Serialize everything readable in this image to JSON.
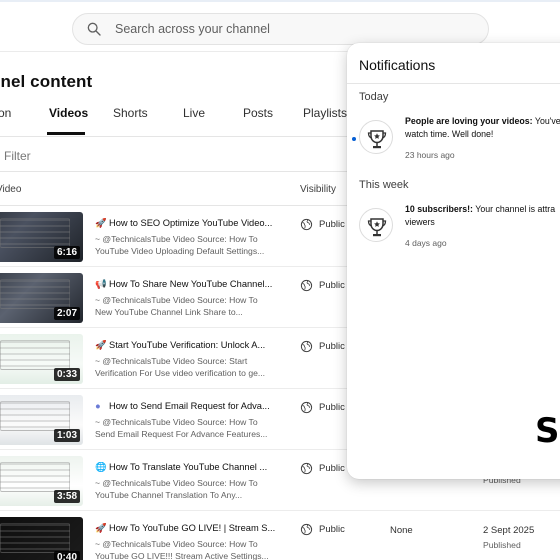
{
  "search": {
    "placeholder": "Search across your channel"
  },
  "page": {
    "title": "nnel content"
  },
  "tabs": [
    {
      "label": "tion"
    },
    {
      "label": "Videos"
    },
    {
      "label": "Shorts"
    },
    {
      "label": "Live"
    },
    {
      "label": "Posts"
    },
    {
      "label": "Playlists"
    }
  ],
  "filter": {
    "label": "Filter"
  },
  "columns": {
    "video": "Video",
    "visibility": "Visibility"
  },
  "rows": [
    {
      "emoji": "rocket",
      "title": "How to SEO Optimize YouTube Video...",
      "desc1": "~ @TechnicalsTube Video Source: How To",
      "desc2": "YouTube Video Uploading Default Settings...",
      "duration": "6:16",
      "visibility": "Public",
      "restrictions": "",
      "date": "",
      "date_sub": ""
    },
    {
      "emoji": "megaphone",
      "title": "How To Share New YouTube Channel...",
      "desc1": "~ @TechnicalsTube Video Source: How To",
      "desc2": "New YouTube Channel Link Share to...",
      "duration": "2:07",
      "visibility": "Public",
      "restrictions": "",
      "date": "",
      "date_sub": ""
    },
    {
      "emoji": "rocket",
      "title": "Start YouTube Verification: Unlock A...",
      "desc1": "~ @TechnicalsTube Video Source: Start",
      "desc2": "Verification For Use video verification to ge...",
      "duration": "0:33",
      "visibility": "Public",
      "restrictions": "",
      "date": "",
      "date_sub": ""
    },
    {
      "emoji": "circle",
      "title": "How to Send Email Request for Adva...",
      "desc1": "~ @TechnicalsTube Video Source: How To",
      "desc2": "Send Email Request For Advance Features...",
      "duration": "1:03",
      "visibility": "Public",
      "restrictions": "",
      "date": "",
      "date_sub": ""
    },
    {
      "emoji": "globe",
      "title": "How To Translate YouTube Channel ...",
      "desc1": "~ @TechnicalsTube Video Source: How To",
      "desc2": "YouTube Channel Translation To Any...",
      "duration": "3:58",
      "visibility": "Public",
      "restrictions": "",
      "date": "",
      "date_sub": "Published"
    },
    {
      "emoji": "rocket",
      "title": "How To YouTube GO LIVE! | Stream S...",
      "desc1": "~ @TechnicalsTube Video Source: How To",
      "desc2": "YouTube GO LIVE!!! Stream Active Settings...",
      "duration": "0:40",
      "visibility": "Public",
      "restrictions": "None",
      "date": "2 Sept 2025",
      "date_sub": "Published"
    }
  ],
  "notifications": {
    "title": "Notifications",
    "sections": [
      {
        "label": "Today",
        "items": [
          {
            "bold": "People are loving your videos:",
            "text": " You've",
            "line2": "watch time. Well done!",
            "time": "23 hours ago",
            "unread": true
          }
        ]
      },
      {
        "label": "This week",
        "items": [
          {
            "bold": "10 subscribers!:",
            "text": " Your channel is attra",
            "line2": "viewers",
            "time": "4 days ago",
            "unread": false
          }
        ]
      }
    ]
  },
  "overlay": {
    "text": "Sc"
  },
  "colors": {
    "accent": "#065fd4",
    "text": "#0f0f0f",
    "muted": "#606060"
  }
}
